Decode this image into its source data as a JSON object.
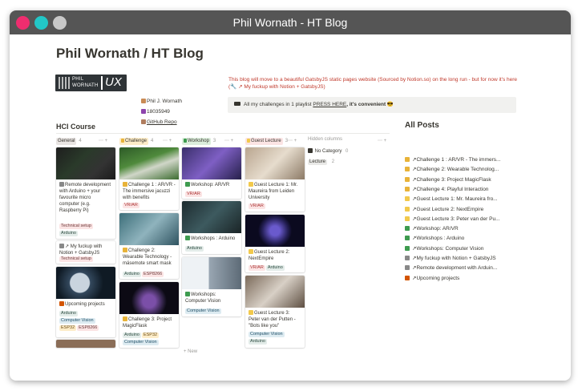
{
  "window": {
    "title": "Phil Wornath - HT Blog",
    "buttons": {
      "close_color": "#ee2d6f",
      "min_color": "#22c7c7",
      "max_color": "#c8c8c8"
    }
  },
  "page": {
    "title": "Phil Wornath / HT Blog",
    "logo": {
      "line1": "PHIL",
      "line2": "WORNATH",
      "ux": "UX"
    },
    "meta": {
      "name": "Phil J. Wornath",
      "phone": "18035949",
      "github": "GitHub Repo"
    },
    "notice": "This blog will move to a beautiful GatsbyJS static pages website (Sourced by Notion.so) on the long run - but for now it's here (🔧 ↗ My fuckup with Notion + GatsbyJS)",
    "playlist": {
      "prefix": "All my challenges in 1 playlist",
      "link": "PRESS HERE",
      "suffix": ", it's convenient 😎"
    }
  },
  "board": {
    "title": "HCI Course",
    "hidden_label": "Hidden columns",
    "hidden_controls": "⋯ +",
    "columns": [
      {
        "name": "General",
        "count": "4",
        "color": "#e9e5e3"
      },
      {
        "name": "Challenge",
        "count": "4",
        "color": "#fdecc8"
      },
      {
        "name": "Workshop",
        "count": "3",
        "color": "#dbeddb"
      },
      {
        "name": "Guest Lecture",
        "count": "3",
        "color": "#fbe4e4"
      }
    ],
    "hidden_rows": [
      {
        "label": "No Category",
        "count": "0"
      },
      {
        "label": "Lecture",
        "count": "2"
      }
    ],
    "column_controls": "⋯ +",
    "cards_general": [
      {
        "title": "Remote development with Arduino + your favourite micro computer (e.g. Raspberry Pi)",
        "tags": [
          "Technical setup",
          "Arduino"
        ]
      },
      {
        "title": "↗ My fuckup with Notion + GatsbyJS",
        "tags": [
          "Technical setup"
        ]
      },
      {
        "title": "Upcoming projects",
        "tags": [
          "Arduino",
          "Computer Vision",
          "ESP32",
          "ESP8266"
        ]
      }
    ],
    "cards_challenge": [
      {
        "title": "Challenge 1 : AR/VR - The immersive jacuzzi with benefits",
        "tags": [
          "VR/AR"
        ]
      },
      {
        "title": "Challenge 2: Wearable Technology - mäsemote smart mask",
        "tags": [
          "Arduino",
          "ESP8266"
        ]
      },
      {
        "title": "Challenge 3: Project MagicFlask",
        "tags": [
          "Arduino",
          "ESP32",
          "Computer Vision"
        ]
      }
    ],
    "cards_workshop": [
      {
        "title": "Workshop: AR/VR",
        "tags": [
          "VR/AR"
        ]
      },
      {
        "title": "Workshops : Arduino",
        "tags": [
          "Arduino"
        ]
      },
      {
        "title": "Workshops: Computer Vision",
        "tags": [
          "Computer Vision"
        ]
      }
    ],
    "cards_guest": [
      {
        "title": "Guest Lecture 1: Mr. Maureira from Leiden University",
        "tags": [
          "VR/AR"
        ]
      },
      {
        "title": "Guest Lecture 2: NextEmpire",
        "tags": [
          "VR/AR",
          "Arduino"
        ]
      },
      {
        "title": "Guest Lecture 3: Peter van der Putten - \"Bots like you\"",
        "tags": [
          "Computer Vision",
          "Arduino"
        ]
      }
    ],
    "new_label": "+ New"
  },
  "all_posts": {
    "title": "All Posts",
    "items": [
      {
        "icon": "lightning-icon",
        "label": "↗Challenge 1 : AR/VR - The immers..."
      },
      {
        "icon": "lightning-icon",
        "label": "↗Challenge 2: Wearable Technolog..."
      },
      {
        "icon": "lightning-icon",
        "label": "↗Challenge 3: Project MagicFlask"
      },
      {
        "icon": "lightning-icon",
        "label": "↗Challenge 4: Playful Interaction"
      },
      {
        "icon": "bulb-icon",
        "label": "↗Guest Lecture 1: Mr. Maureira fro..."
      },
      {
        "icon": "bulb-icon",
        "label": "↗Guest Lecture 2: NextEmpire"
      },
      {
        "icon": "bulb-icon",
        "label": "↗Guest Lecture 3: Peter van der Pu..."
      },
      {
        "icon": "test-tube-icon",
        "label": "↗Workshop: AR/VR"
      },
      {
        "icon": "test-tube-icon",
        "label": "↗Workshops : Arduino"
      },
      {
        "icon": "test-tube-icon",
        "label": "↗Workshops: Computer Vision"
      },
      {
        "icon": "wrench-icon",
        "label": "↗My fuckup with Notion + GatsbyJS"
      },
      {
        "icon": "wrench-icon",
        "label": "↗Remote development with Arduin..."
      },
      {
        "icon": "rocket-icon",
        "label": "↗Upcoming projects"
      }
    ]
  }
}
